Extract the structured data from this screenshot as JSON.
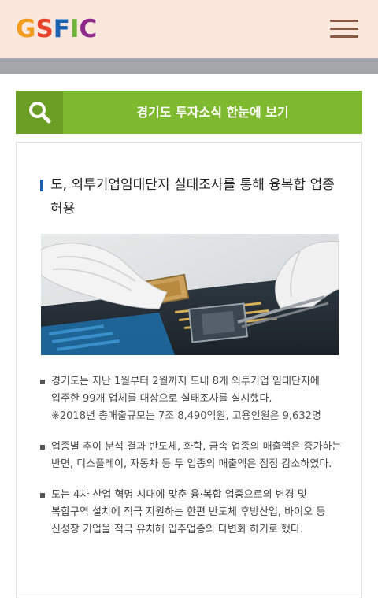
{
  "header": {
    "logo": [
      {
        "letter": "G",
        "color": "#f39c1e"
      },
      {
        "letter": "S",
        "color": "#e8432c"
      },
      {
        "letter": "F",
        "color": "#1a64b4"
      },
      {
        "letter": "I",
        "color": "#70b33a"
      },
      {
        "letter": "C",
        "color": "#8e2a8c"
      }
    ],
    "menu_icon": "hamburger-menu-icon"
  },
  "search_bar": {
    "icon": "search-icon",
    "label": "경기도 투자소식 한눈에 보기"
  },
  "article": {
    "title": "도, 외투기업임대단지 실태조사를 통해 융복합 업종 허용",
    "image_alt": "gloved hands placing a chip on a circuit board",
    "bullets": [
      {
        "text": "경기도는 지난 1월부터 2월까지 도내 8개 외투기업 임대단지에 입주한 99개 업체를 대상으로 실태조사를 실시했다.",
        "note": "※2018년 총매출규모는 7조 8,490억원, 고용인원은 9,632명"
      },
      {
        "text": "업종별 추이 분석 결과 반도체, 화학, 금속 업종의 매출액은 증가하는 반면, 디스플레이, 자동차 등 두 업종의 매출액은 점점 감소하였다."
      },
      {
        "text": "도는 4차 산업 혁명 시대에 맞춘 융·복합 업종으로의 변경 및 복합구역 설치에 적극 지원하는 한편 반도체 후방산업, 바이오 등 신성장 기업을 적극 유치해 입주업종의 다변화 하기로 했다."
      }
    ]
  },
  "colors": {
    "header_bg": "#fbe7dc",
    "search_green": "#7fb930",
    "search_icon_bg": "#6c9e25",
    "title_mark": "#1f5fa8"
  }
}
